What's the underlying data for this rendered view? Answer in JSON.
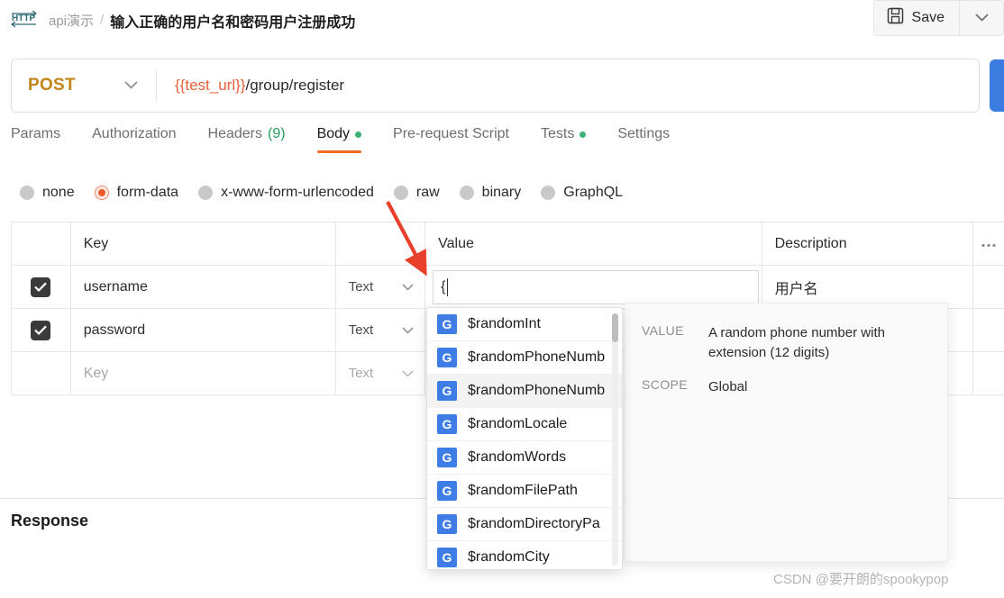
{
  "topbar": {
    "protocol_icon": "http-icon",
    "breadcrumb_folder": "api演示",
    "breadcrumb_separator": "/",
    "breadcrumb_title": "输入正确的用户名和密码用户注册成功",
    "save_label": "Save",
    "save_icon": "floppy-disk-icon",
    "save_caret_icon": "chevron-down-icon"
  },
  "url_bar": {
    "method": "POST",
    "method_caret_icon": "chevron-down-icon",
    "url_variable": "{{test_url}}",
    "url_path": "/group/register",
    "send_label": ""
  },
  "request_tabs": [
    {
      "label": "Params",
      "active": false,
      "count": "",
      "dot": false
    },
    {
      "label": "Authorization",
      "active": false,
      "count": "",
      "dot": false
    },
    {
      "label": "Headers",
      "active": false,
      "count": "(9)",
      "dot": false
    },
    {
      "label": "Body",
      "active": true,
      "count": "",
      "dot": true
    },
    {
      "label": "Pre-request Script",
      "active": false,
      "count": "",
      "dot": false
    },
    {
      "label": "Tests",
      "active": false,
      "count": "",
      "dot": true
    },
    {
      "label": "Settings",
      "active": false,
      "count": "",
      "dot": false
    }
  ],
  "body_types": [
    {
      "label": "none",
      "selected": false
    },
    {
      "label": "form-data",
      "selected": true
    },
    {
      "label": "x-www-form-urlencoded",
      "selected": false
    },
    {
      "label": "raw",
      "selected": false
    },
    {
      "label": "binary",
      "selected": false
    },
    {
      "label": "GraphQL",
      "selected": false
    }
  ],
  "param_table": {
    "headers": {
      "key": "Key",
      "value": "Value",
      "description": "Description",
      "more_icon": "ellipsis-icon"
    },
    "rows": [
      {
        "checked": true,
        "key": "username",
        "type": "Text",
        "value": "{",
        "description": "用户名",
        "placeholder": false
      },
      {
        "checked": true,
        "key": "password",
        "type": "Text",
        "value": "",
        "description": "",
        "placeholder": false
      },
      {
        "checked": false,
        "key": "Key",
        "type": "Text",
        "value": "",
        "description": "",
        "placeholder": true
      }
    ]
  },
  "autocomplete": {
    "items": [
      {
        "badge": "G",
        "name": "$randomInt",
        "highlighted": false
      },
      {
        "badge": "G",
        "name": "$randomPhoneNumb",
        "highlighted": false
      },
      {
        "badge": "G",
        "name": "$randomPhoneNumb",
        "highlighted": true
      },
      {
        "badge": "G",
        "name": "$randomLocale",
        "highlighted": false
      },
      {
        "badge": "G",
        "name": "$randomWords",
        "highlighted": false
      },
      {
        "badge": "G",
        "name": "$randomFilePath",
        "highlighted": false
      },
      {
        "badge": "G",
        "name": "$randomDirectoryPa",
        "highlighted": false
      },
      {
        "badge": "G",
        "name": "$randomCity",
        "highlighted": false
      }
    ]
  },
  "tooltip": {
    "value_key": "VALUE",
    "value_text": "A random phone number with extension (12 digits)",
    "scope_key": "SCOPE",
    "scope_text": "Global"
  },
  "response": {
    "title": "Response"
  },
  "annotation": {
    "arrow_color": "#e8402a"
  },
  "watermark": {
    "text": "CSDN @要开朗的spookypop"
  },
  "colors": {
    "accent_orange": "#f26b21",
    "method_post": "#c1851a",
    "url_variable": "#e8603c",
    "send_blue": "#3a7ce0",
    "badge_blue": "#3d7de5",
    "green_dot": "#3bb273",
    "arrow_red": "#e8402a"
  }
}
